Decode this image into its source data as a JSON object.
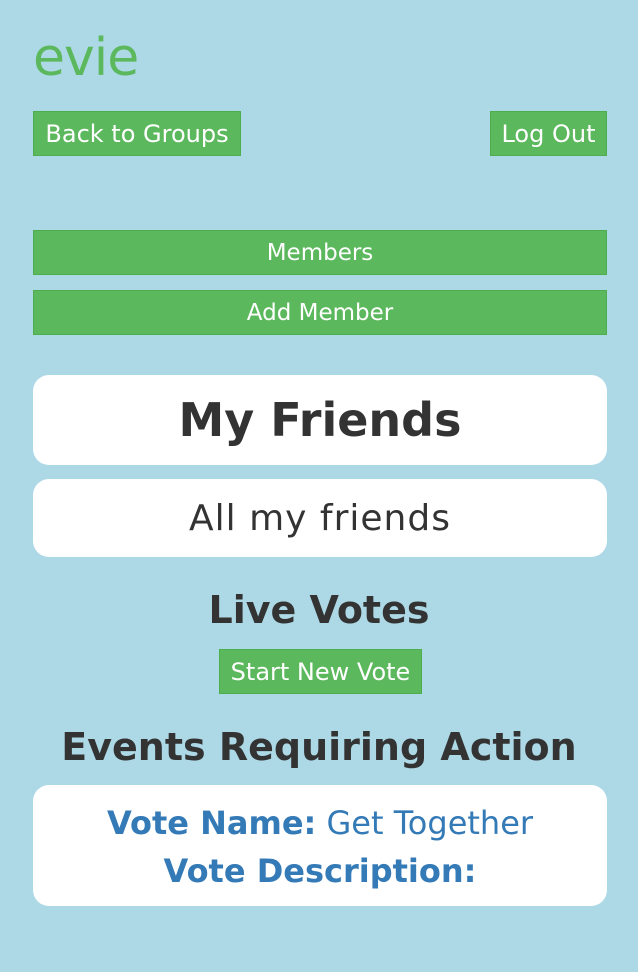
{
  "header": {
    "logo": "evie",
    "back_label": "Back to Groups",
    "logout_label": "Log Out"
  },
  "actions": {
    "members_label": "Members",
    "add_member_label": "Add Member"
  },
  "friends": {
    "title": "My Friends",
    "all_label": "All my friends"
  },
  "live_votes": {
    "heading": "Live Votes",
    "start_label": "Start New Vote"
  },
  "events": {
    "heading": "Events Requiring Action",
    "items": [
      {
        "name_label": "Vote Name:",
        "name_value": "Get Together",
        "description_label": "Vote Description:",
        "description_value": ""
      }
    ]
  },
  "colors": {
    "background": "#add8e6",
    "accent": "#5cb85c",
    "link": "#337ab7",
    "text": "#333333"
  }
}
